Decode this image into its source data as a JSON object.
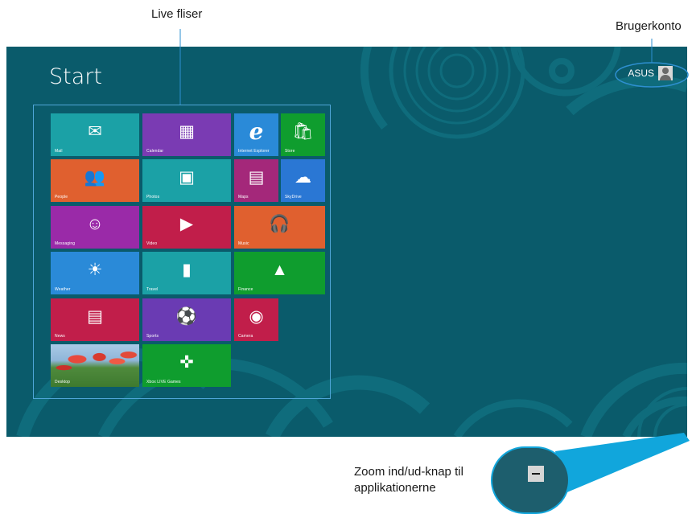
{
  "callouts": {
    "live_tiles": "Live fliser",
    "user_account": "Brugerkonto",
    "zoom_line1": "Zoom ind/ud-knap til",
    "zoom_line2": "applikationerne"
  },
  "start": {
    "title": "Start",
    "user_name": "ASUS",
    "background_color": "#0a5b6b"
  },
  "tiles": [
    {
      "label": "Mail",
      "icon": "mail-icon",
      "color": "#1ba1a6"
    },
    {
      "label": "Calendar",
      "icon": "calendar-icon",
      "color": "#7a3bb3"
    },
    {
      "label": "Internet Explorer",
      "icon": "internet-explorer-icon",
      "color": "#2a8ad8"
    },
    {
      "label": "Store",
      "icon": "store-icon",
      "color": "#0f9d2e"
    },
    {
      "label": "People",
      "icon": "people-icon",
      "color": "#e0602f"
    },
    {
      "label": "Photos",
      "icon": "photos-icon",
      "color": "#1ba1a6"
    },
    {
      "label": "Maps",
      "icon": "maps-icon",
      "color": "#a4287a"
    },
    {
      "label": "SkyDrive",
      "icon": "skydrive-icon",
      "color": "#2a77d4"
    },
    {
      "label": "Messaging",
      "icon": "messaging-icon",
      "color": "#9a2aa8"
    },
    {
      "label": "Video",
      "icon": "video-icon",
      "color": "#c11e4a"
    },
    {
      "label": "Music",
      "icon": "music-icon",
      "color": "#e0602f"
    },
    {
      "label": "Weather",
      "icon": "weather-icon",
      "color": "#2a8ad8"
    },
    {
      "label": "Travel",
      "icon": "travel-icon",
      "color": "#1ba1a6"
    },
    {
      "label": "Finance",
      "icon": "finance-icon",
      "color": "#0f9d2e"
    },
    {
      "label": "News",
      "icon": "news-icon",
      "color": "#c11e4a"
    },
    {
      "label": "Sports",
      "icon": "sports-icon",
      "color": "#6a3bb3"
    },
    {
      "label": "Camera",
      "icon": "camera-icon",
      "color": "#c11e4a"
    },
    {
      "label": "Desktop",
      "icon": "desktop-photo",
      "color": "#4f8a3c"
    },
    {
      "label": "Xbox LIVE Games",
      "icon": "xbox-controller-icon",
      "color": "#0f9d2e"
    }
  ]
}
